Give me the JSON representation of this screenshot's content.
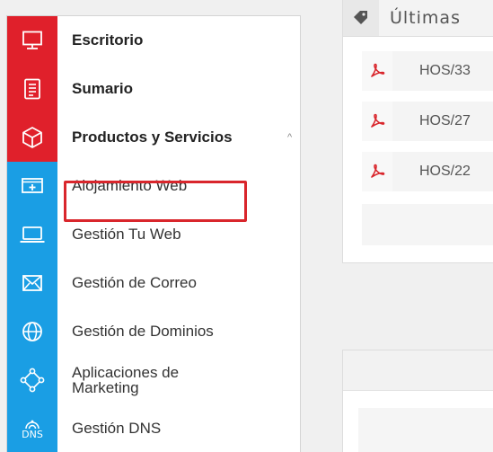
{
  "sidebar": {
    "items": [
      {
        "label": "Escritorio",
        "icon": "monitor-icon"
      },
      {
        "label": "Sumario",
        "icon": "list-document-icon"
      },
      {
        "label": "Productos y Servicios",
        "icon": "cube-icon",
        "chevron": "^"
      },
      {
        "label": "Alojamiento Web",
        "icon": "hosting-plus-icon"
      },
      {
        "label": "Gestión Tu Web",
        "icon": "laptop-icon"
      },
      {
        "label": "Gestión de Correo",
        "icon": "envelope-icon"
      },
      {
        "label": "Gestión de Dominios",
        "icon": "globe-icon"
      },
      {
        "label_line1": "Aplicaciones de",
        "label_line2": "Marketing",
        "icon": "network-icon"
      },
      {
        "label": "Gestión DNS",
        "icon": "dns-icon",
        "icon_text": "DNS"
      }
    ]
  },
  "invoices": {
    "title": "Últimas",
    "rows": [
      {
        "text": "HOS/33"
      },
      {
        "text": "HOS/27"
      },
      {
        "text": "HOS/22"
      }
    ]
  },
  "colors": {
    "red": "#e0202b",
    "blue": "#1a9ee4",
    "highlight": "#d9262c"
  }
}
